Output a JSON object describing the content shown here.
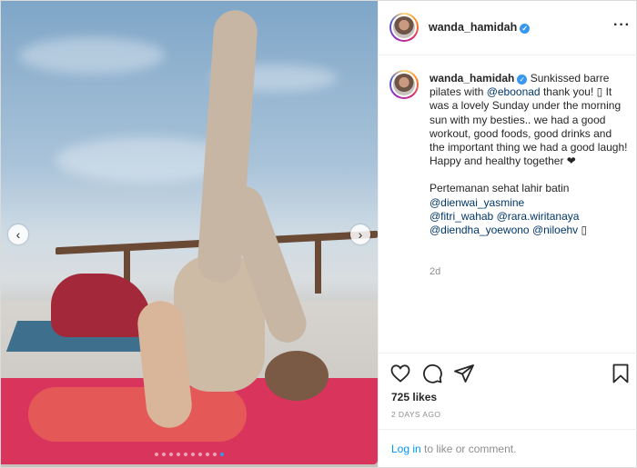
{
  "post": {
    "username": "wanda_hamidah",
    "verified": true,
    "caption": {
      "line1_pre": " Sunkissed barre pilates with ",
      "mention1": "@eboonad",
      "line1_post": " thank you! ▯ It was a lovely Sunday under the morning sun with my besties.. we had a good workout, good foods, good drinks and the important thing we had a good laugh! Happy and healthy together ❤",
      "para2": "Pertemanan sehat lahir batin",
      "mentions": [
        "@dienwai_yasmine",
        "@fitri_wahab",
        "@rara.wiritanaya",
        "@diendha_yoewono",
        "@niloehv"
      ],
      "trailing_emoji": " ▯"
    },
    "time_ago": "2d",
    "likes": "725 likes",
    "date": "2 DAYS AGO",
    "login_link": "Log in",
    "login_rest": " to like or comment."
  },
  "carousel": {
    "total": 10,
    "active": 9
  },
  "icons": {
    "more": "more-options-icon",
    "heart": "heart-icon",
    "comment": "comment-icon",
    "share": "share-icon",
    "bookmark": "bookmark-icon",
    "verified": "verified-badge-icon"
  },
  "colors": {
    "link": "#0095f6",
    "mention": "#00376b",
    "verified": "#3897f0",
    "muted": "#8e8e8e"
  }
}
